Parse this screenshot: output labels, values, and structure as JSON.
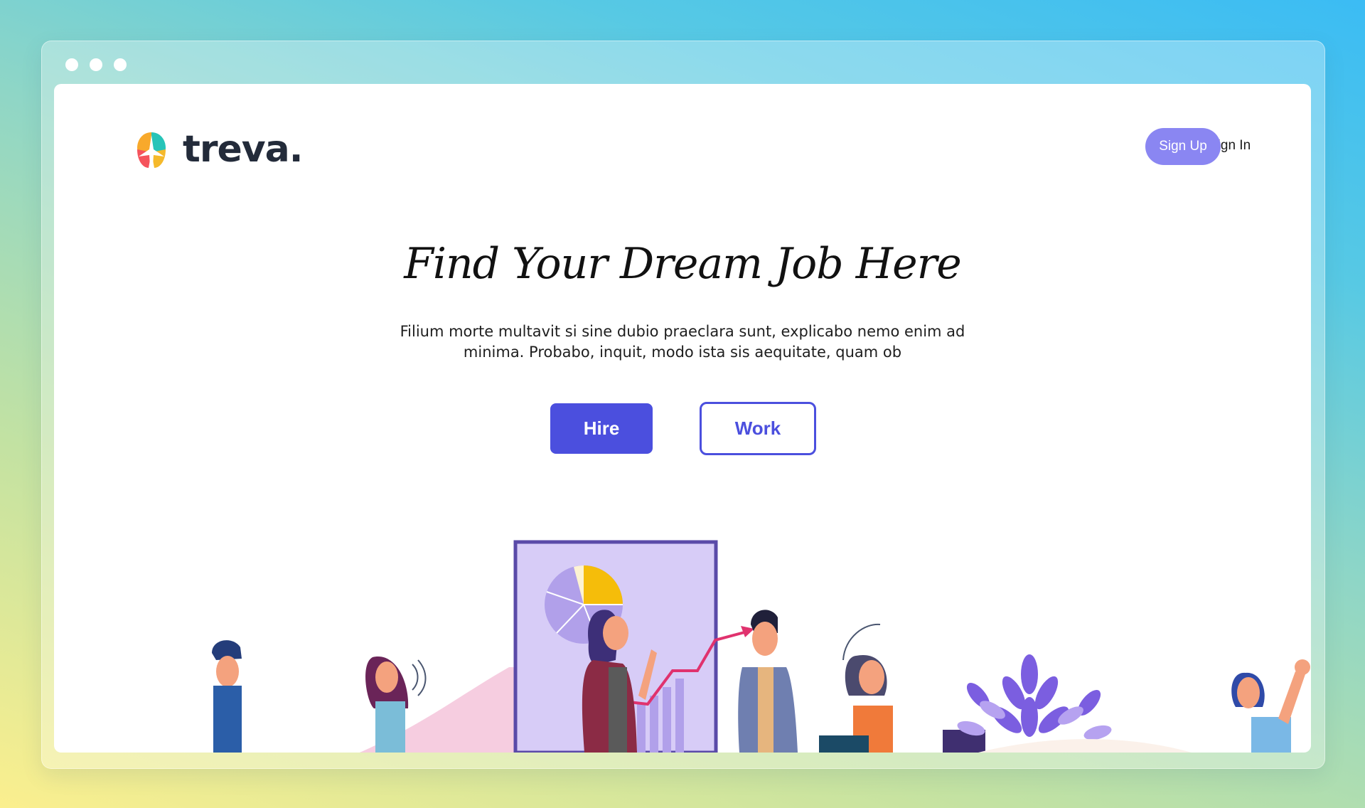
{
  "window": {
    "controls": [
      "dot",
      "dot",
      "dot"
    ]
  },
  "header": {
    "logo_text": "treva.",
    "sign_in_label": "Sign In",
    "sign_up_label": "Sign Up"
  },
  "hero": {
    "title": "Find Your Dream Job Here",
    "description": "Filium morte multavit si sine dubio praeclara sunt, explicabo nemo enim ad minima. Probabo, inquit, modo ista sis aequitate, quam ob",
    "hire_label": "Hire",
    "work_label": "Work"
  },
  "colors": {
    "accent": "#4b4fde",
    "signup": "#8a86f2",
    "illustration_purple": "#7b5ee0",
    "illustration_lilac": "#d7ccf7",
    "illustration_pink": "#f6cde0",
    "illustration_yellow": "#f5bd0a"
  }
}
